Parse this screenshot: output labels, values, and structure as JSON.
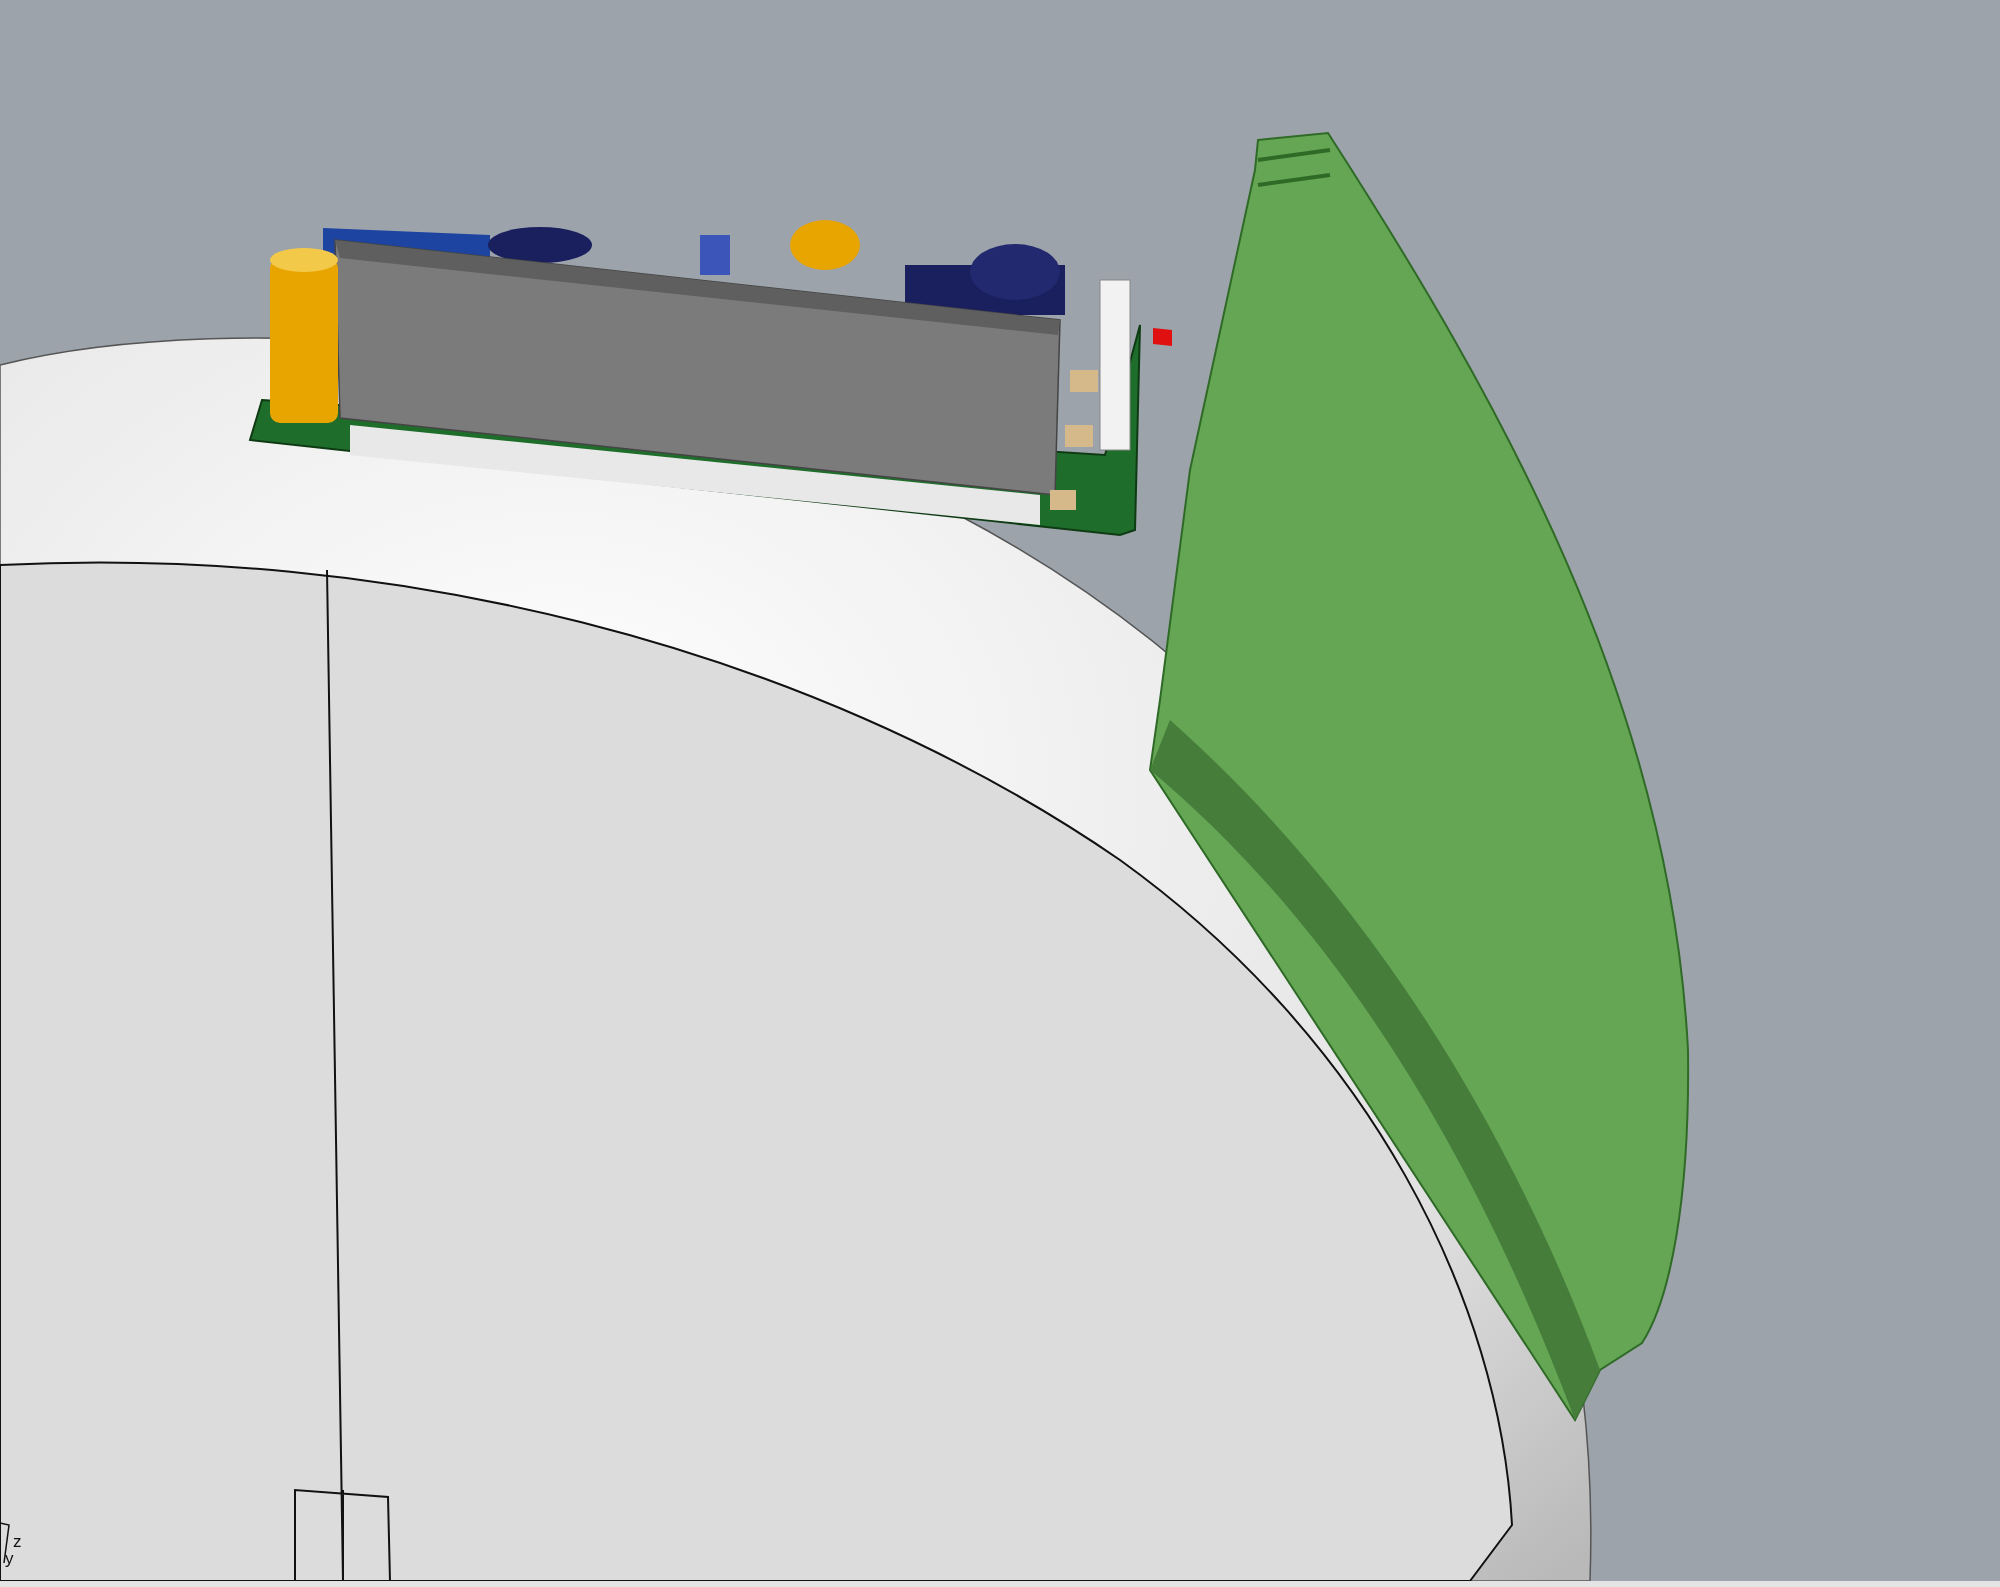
{
  "viewport": {
    "axis_labels": {
      "z": "z",
      "y": "y"
    }
  }
}
